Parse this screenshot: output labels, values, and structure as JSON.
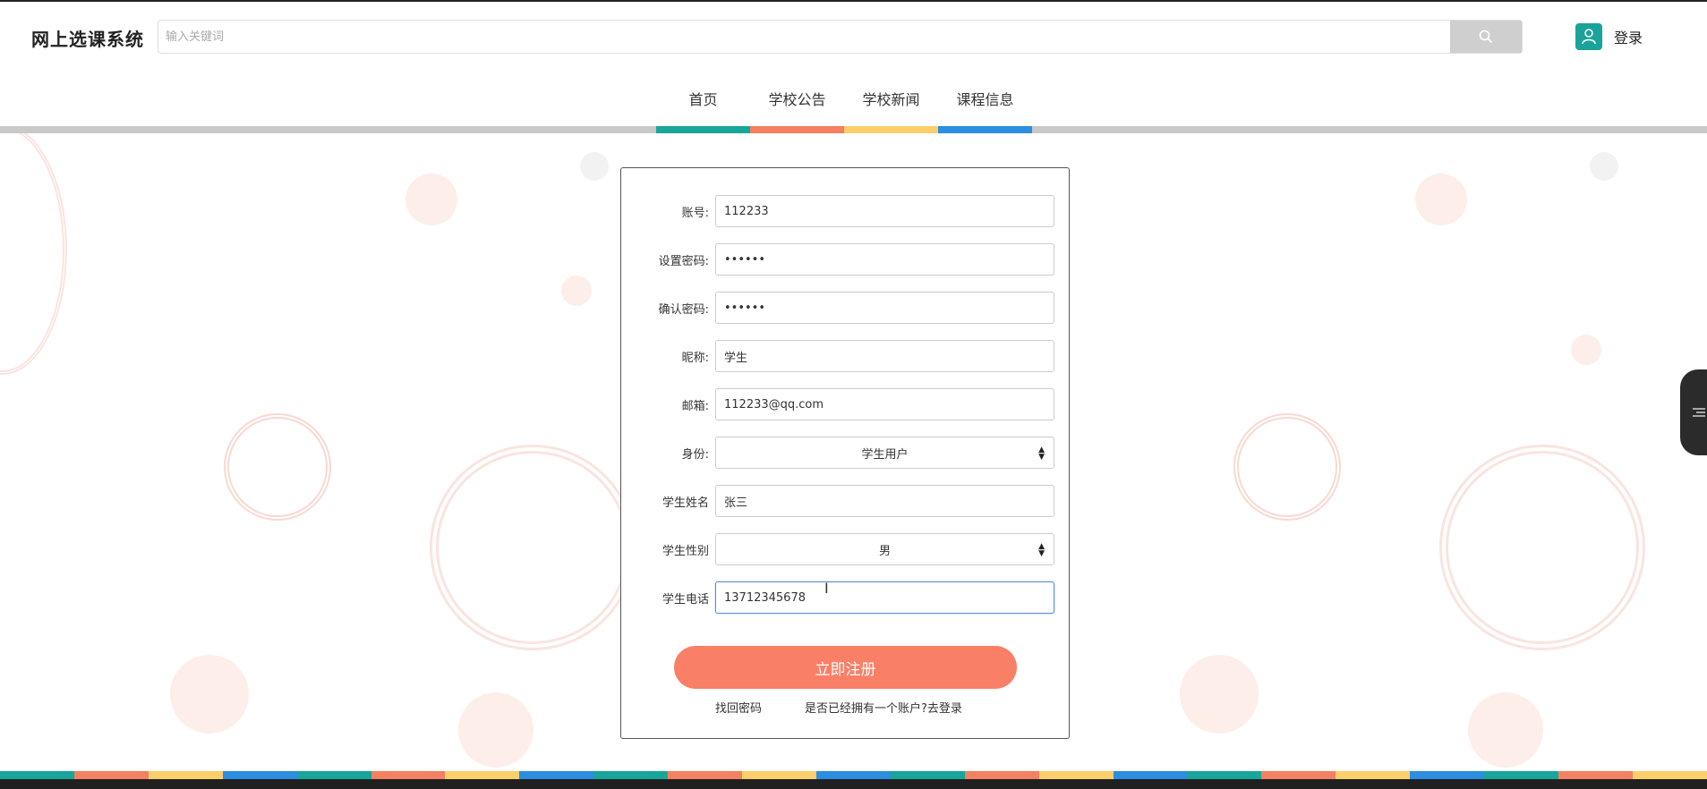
{
  "header": {
    "title": "网上选课系统",
    "search_placeholder": "输入关键词",
    "login_label": "登录"
  },
  "nav": {
    "items": [
      "首页",
      "学校公告",
      "学校新闻",
      "课程信息"
    ],
    "colors": [
      "#18a69a",
      "#f28061",
      "#fccf6a",
      "#2b8edf"
    ]
  },
  "form": {
    "account_label": "账号:",
    "account_value": "112233",
    "password_label": "设置密码:",
    "password_value": "123456",
    "confirm_label": "确认密码:",
    "confirm_value": "123456",
    "nickname_label": "昵称:",
    "nickname_value": "学生",
    "email_label": "邮箱:",
    "email_value": "112233@qq.com",
    "role_label": "身份:",
    "role_value": "学生用户",
    "name_label": "学生姓名",
    "name_value": "张三",
    "gender_label": "学生性别",
    "gender_value": "男",
    "phone_label": "学生电话",
    "phone_value": "13712345678",
    "submit_label": "立即注册",
    "forgot_label": "找回密码",
    "login_prompt": "是否已经拥有一个账户?去登录"
  },
  "colors": {
    "accent": "#fa7f67",
    "teal": "#18a69a"
  }
}
